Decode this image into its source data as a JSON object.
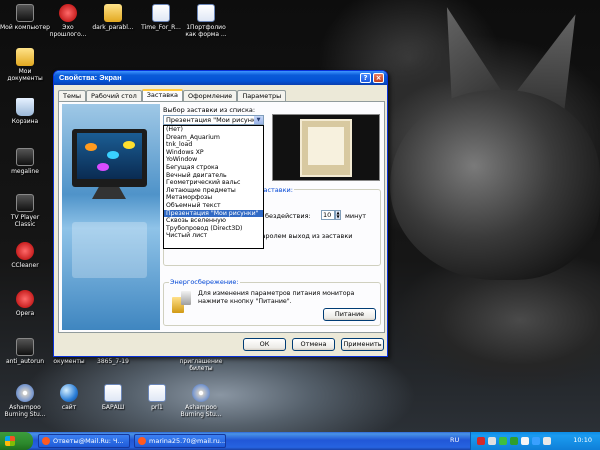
{
  "desktop": {
    "icons": [
      {
        "label": "Мой компьютер"
      },
      {
        "label": "Эхо прошлого..."
      },
      {
        "label": "dark_parabl..."
      },
      {
        "label": "Time_For_R..."
      },
      {
        "label": "1Портфолио как форма ..."
      },
      {
        "label": "Мои документы"
      },
      {
        "label": "Корзина"
      },
      {
        "label": "megaline"
      },
      {
        "label": "TV Player Classic"
      },
      {
        "label": "CCleaner"
      },
      {
        "label": "Opera"
      },
      {
        "label": "anti_autorun"
      },
      {
        "label": "окументы"
      },
      {
        "label": "3865_7-19"
      },
      {
        "label": "приглашение билеты"
      },
      {
        "label": "Ashampoo Burning Stu..."
      },
      {
        "label": "сайт"
      },
      {
        "label": "БАРАШ"
      },
      {
        "label": "prl1"
      },
      {
        "label": "Ashampoo Burning Stu..."
      }
    ]
  },
  "dialog": {
    "title": "Свойства: Экран",
    "tabs": [
      "Темы",
      "Рабочий стол",
      "Заставка",
      "Оформление",
      "Параметры"
    ],
    "active_tab": "Заставка",
    "screensaver": {
      "label": "Выбор заставки из списка:",
      "selected": "Презентация \"Мои рисунки\"",
      "options": [
        "(Нет)",
        "Dream_Aquarium",
        "tnk_load",
        "Windows XP",
        "YoWindow",
        "Бегущая строка",
        "Вечный двигатель",
        "Геометрический вальс",
        "Летающие предметы",
        "Метаморфозы",
        "Объемный текст",
        "Презентация \"Мои рисунки\"",
        "Сквозь вселенную",
        "Трубопровод (Direct3D)",
        "Чистый лист"
      ],
      "group_legend": "заставки:",
      "interval_label": "бездействия:",
      "interval_value": "10",
      "interval_unit": "минут",
      "password_label": "Защитить паролем выход из заставки",
      "password_checked": false
    },
    "power": {
      "legend": "Энергосбережение:",
      "text": "Для изменения параметров питания монитора нажмите кнопку \"Питание\".",
      "button": "Питание"
    },
    "buttons": {
      "ok": "ОК",
      "cancel": "Отмена",
      "apply": "Применить"
    }
  },
  "taskbar": {
    "tasks": [
      "Ответы@Mail.Ru: Ч...",
      "marina25.70@mail.ru..."
    ],
    "language": "RU",
    "clock": "10:10"
  },
  "colors": {
    "titlebar": "#0453d6",
    "selection": "#316ac5",
    "taskbar": "#2157d7",
    "start_button": "#2d8a2d",
    "dialog_bg": "#ece9d8"
  }
}
